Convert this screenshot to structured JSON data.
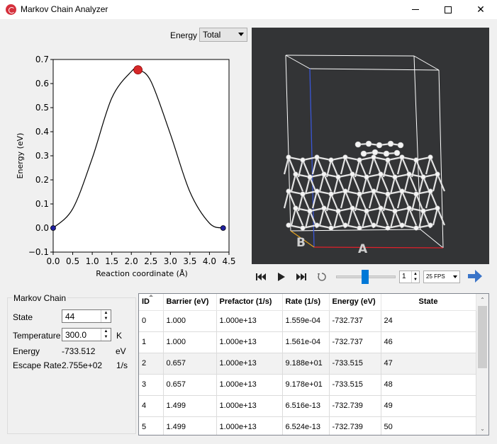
{
  "window": {
    "title": "Markov Chain Analyzer"
  },
  "energy_selector": {
    "label": "Energy",
    "value": "Total"
  },
  "plot": {
    "ylabel": "Energy (eV)",
    "xlabel": "Reaction coordinate (Å)",
    "yticks": [
      "0.7",
      "0.6",
      "0.5",
      "0.4",
      "0.3",
      "0.2",
      "0.1",
      "0.0",
      "−0.1"
    ],
    "xticks": [
      "0.0",
      "0.5",
      "1.0",
      "1.5",
      "2.0",
      "2.5",
      "3.0",
      "3.5",
      "4.0",
      "4.5"
    ],
    "line_color": "#000000",
    "highlight_color": "#d62728",
    "endpoint_color": "#1f1fa0"
  },
  "chart_data": {
    "type": "line",
    "title": "",
    "xlabel": "Reaction coordinate (Å)",
    "ylabel": "Energy (eV)",
    "xlim": [
      0.0,
      4.5
    ],
    "ylim": [
      -0.1,
      0.7
    ],
    "series": [
      {
        "x": [
          0.0,
          0.5,
          1.0,
          1.5,
          2.0,
          2.17,
          2.5,
          3.0,
          3.5,
          4.0,
          4.35
        ],
        "y": [
          0.0,
          0.08,
          0.29,
          0.54,
          0.65,
          0.657,
          0.61,
          0.39,
          0.15,
          0.02,
          0.0
        ]
      }
    ],
    "markers": [
      {
        "x": 0.0,
        "y": 0.0,
        "color": "endpoint"
      },
      {
        "x": 2.17,
        "y": 0.657,
        "color": "highlight"
      },
      {
        "x": 4.35,
        "y": 0.0,
        "color": "endpoint"
      }
    ],
    "grid": false
  },
  "viewer": {
    "axis_label_b": "B",
    "axis_label_a": "A",
    "background": "#333436"
  },
  "playback": {
    "frame": "1",
    "fps": "25 FPS"
  },
  "markov": {
    "group_title": "Markov Chain",
    "state_label": "State",
    "state_value": "44",
    "temperature_label": "Temperature",
    "temperature_value": "300.0",
    "temperature_unit": "K",
    "energy_label": "Energy",
    "energy_value": "-733.512",
    "energy_unit": "eV",
    "escape_label": "Escape Rate",
    "escape_value": "2.755e+02",
    "escape_unit": "1/s"
  },
  "table": {
    "headers": [
      "ID",
      "Barrier (eV)",
      "Prefactor (1/s)",
      "Rate (1/s)",
      "Energy (eV)",
      "State"
    ],
    "rows": [
      [
        "0",
        "1.000",
        "1.000e+13",
        "1.559e-04",
        "-732.737",
        "24"
      ],
      [
        "1",
        "1.000",
        "1.000e+13",
        "1.561e-04",
        "-732.737",
        "46"
      ],
      [
        "2",
        "0.657",
        "1.000e+13",
        "9.188e+01",
        "-733.515",
        "47"
      ],
      [
        "3",
        "0.657",
        "1.000e+13",
        "9.178e+01",
        "-733.515",
        "48"
      ],
      [
        "4",
        "1.499",
        "1.000e+13",
        "6.516e-13",
        "-732.739",
        "49"
      ],
      [
        "5",
        "1.499",
        "1.000e+13",
        "6.524e-13",
        "-732.739",
        "50"
      ]
    ]
  }
}
